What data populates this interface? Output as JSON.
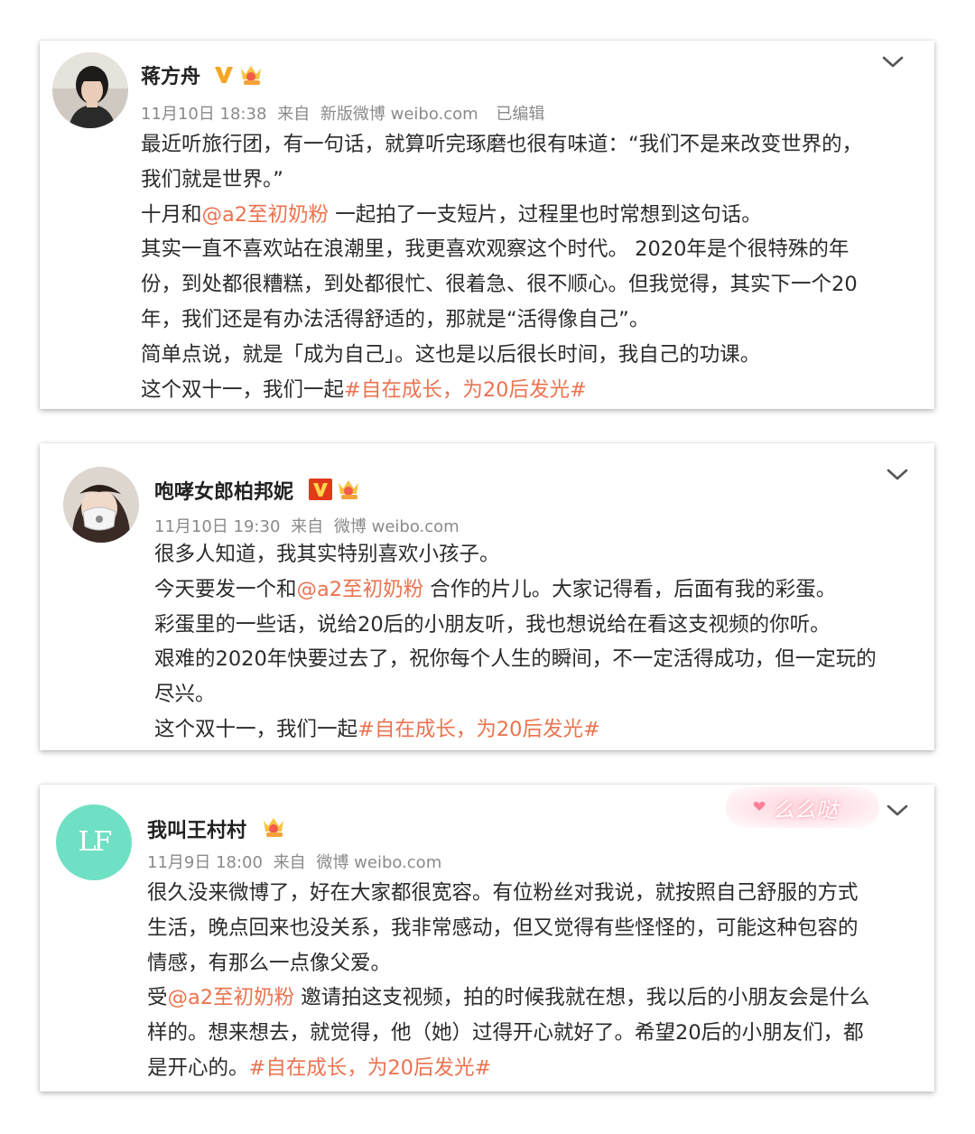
{
  "posts": [
    {
      "user": "蒋方舟",
      "time": "11月10日 18:38",
      "from_label": "来自",
      "source": "新版微博 weibo.com",
      "edited": "已编辑",
      "lines": [
        [
          {
            "t": "最近听旅行团，有一句话，就算听完琢磨也很有味道：“我们不是来改变世界的，"
          }
        ],
        [
          {
            "t": "我们就是世界。”"
          }
        ],
        [
          {
            "t": "十月和"
          },
          {
            "t": "@a2至初奶粉",
            "link": true
          },
          {
            "t": " 一起拍了一支短片，过程里也时常想到这句话。"
          }
        ],
        [
          {
            "t": "其实一直不喜欢站在浪潮里，我更喜欢观察这个时代。 2020年是个很特殊的年"
          }
        ],
        [
          {
            "t": "份，到处都很糟糕，到处都很忙、很着急、很不顺心。但我觉得，其实下一个20"
          }
        ],
        [
          {
            "t": "年，我们还是有办法活得舒适的，那就是“活得像自己”。"
          }
        ],
        [
          {
            "t": "简单点说，就是「成为自己」。这也是以后很长时间，我自己的功课。"
          }
        ],
        [
          {
            "t": "这个双十一，我们一起"
          },
          {
            "t": "#自在成长，为20后发光#",
            "link": true
          }
        ]
      ]
    },
    {
      "user": "咆哮女郎柏邦妮",
      "time": "11月10日 19:30",
      "from_label": "来自",
      "source": "微博 weibo.com",
      "lines": [
        [
          {
            "t": "很多人知道，我其实特别喜欢小孩子。"
          }
        ],
        [
          {
            "t": "今天要发一个和"
          },
          {
            "t": "@a2至初奶粉",
            "link": true
          },
          {
            "t": " 合作的片儿。大家记得看，后面有我的彩蛋。"
          }
        ],
        [
          {
            "t": "彩蛋里的一些话，说给20后的小朋友听，我也想说给在看这支视频的你听。"
          }
        ],
        [
          {
            "t": "艰难的2020年快要过去了，祝你每个人生的瞬间，不一定活得成功，但一定玩的"
          }
        ],
        [
          {
            "t": "尽兴。"
          }
        ],
        [
          {
            "t": "这个双十一，我们一起"
          },
          {
            "t": "#自在成长，为20后发光#",
            "link": true
          }
        ]
      ]
    },
    {
      "user": "我叫王村村",
      "avatar_text": "LF",
      "decoration_text": "么么哒",
      "time": "11月9日 18:00",
      "from_label": "来自",
      "source": "微博 weibo.com",
      "lines": [
        [
          {
            "t": "很久没来微博了，好在大家都很宽容。有位粉丝对我说，就按照自己舒服的方式"
          }
        ],
        [
          {
            "t": "生活，晚点回来也没关系，我非常感动，但又觉得有些怪怪的，可能这种包容的"
          }
        ],
        [
          {
            "t": "情感，有那么一点像父爱。"
          }
        ],
        [
          {
            "t": "受"
          },
          {
            "t": "@a2至初奶粉",
            "link": true
          },
          {
            "t": " 邀请拍这支视频，拍的时候我就在想，我以后的小朋友会是什么"
          }
        ],
        [
          {
            "t": "样的。想来想去，就觉得，他（她）过得开心就好了。希望20后的小朋友们，都"
          }
        ],
        [
          {
            "t": "是开心的。"
          },
          {
            "t": "#自在成长，为20后发光#",
            "link": true
          }
        ]
      ]
    }
  ],
  "colors": {
    "link": "#eb7350",
    "meta": "#8a8a8a",
    "text": "#2b2b2b",
    "avatar_lf": "#6fe0c4"
  },
  "icons": [
    "verified-v-icon",
    "crown-badge-icon",
    "chevron-down-icon"
  ]
}
